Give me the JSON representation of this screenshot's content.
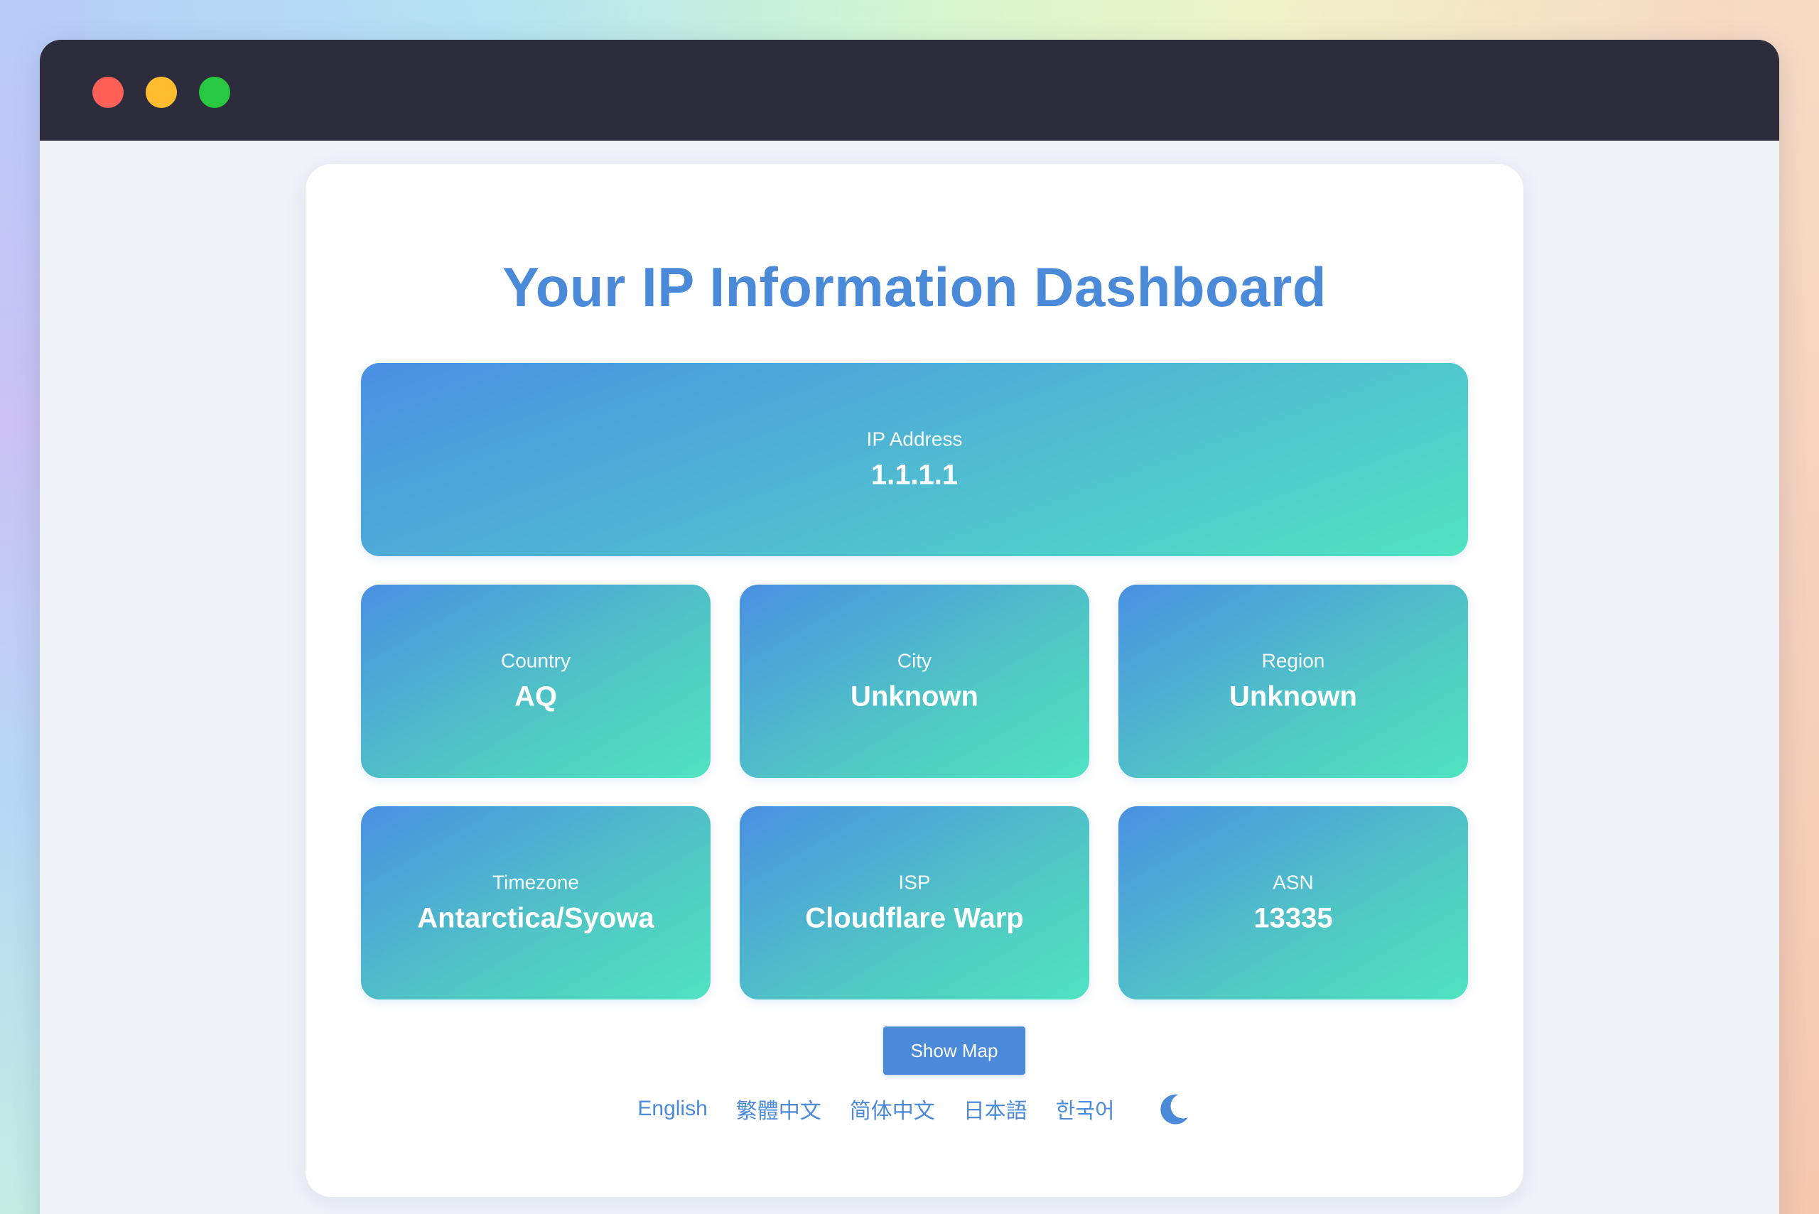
{
  "window": {
    "controls": [
      "close",
      "minimize",
      "maximize"
    ]
  },
  "dashboard": {
    "title": "Your IP Information Dashboard",
    "ip": {
      "label": "IP Address",
      "value": "1.1.1.1"
    },
    "tiles": [
      {
        "label": "Country",
        "value": "AQ"
      },
      {
        "label": "City",
        "value": "Unknown"
      },
      {
        "label": "Region",
        "value": "Unknown"
      },
      {
        "label": "Timezone",
        "value": "Antarctica/Syowa"
      },
      {
        "label": "ISP",
        "value": "Cloudflare Warp"
      },
      {
        "label": "ASN",
        "value": "13335"
      }
    ],
    "show_map_label": "Show Map",
    "languages": [
      "English",
      "繁體中文",
      "简体中文",
      "日本語",
      "한국어"
    ],
    "theme_toggle_icon": "moon-icon"
  },
  "colors": {
    "accent": "#4a8ad9",
    "gradient_start": "#4a90e2",
    "gradient_end": "#50e3c2",
    "titlebar": "#2d2c3c",
    "close": "#fe5f57",
    "minimize": "#febc2e",
    "maximize": "#28c840"
  }
}
